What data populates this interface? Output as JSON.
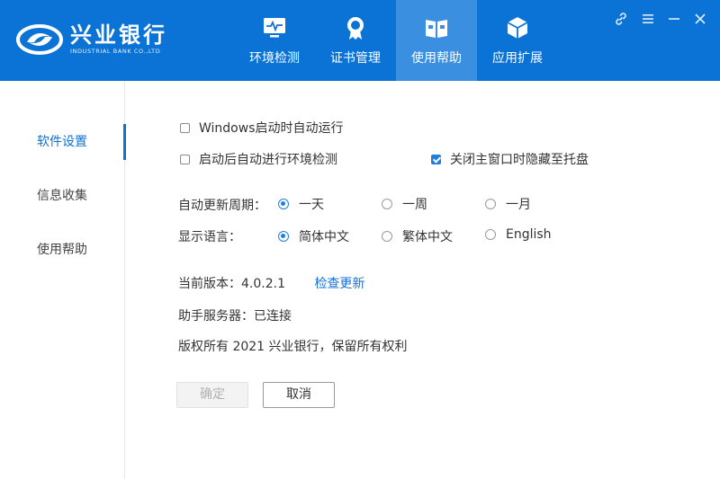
{
  "header": {
    "logo_cn": "兴业银行",
    "logo_en": "INDUSTRIAL BANK CO.,LTD",
    "tabs": [
      {
        "label": "环境检测",
        "icon": "monitor-icon",
        "active": false
      },
      {
        "label": "证书管理",
        "icon": "certificate-icon",
        "active": false
      },
      {
        "label": "使用帮助",
        "icon": "book-icon",
        "active": true
      },
      {
        "label": "应用扩展",
        "icon": "cube-icon",
        "active": false
      }
    ],
    "window_controls": [
      "link-icon",
      "menu-icon",
      "minimize-icon",
      "close-icon"
    ],
    "colors": {
      "bar": "#0c73d6",
      "active_tab": "#3a8fe0"
    }
  },
  "sidebar": {
    "items": [
      {
        "label": "软件设置",
        "active": true
      },
      {
        "label": "信息收集",
        "active": false
      },
      {
        "label": "使用帮助",
        "active": false
      }
    ]
  },
  "settings": {
    "autostart": {
      "label": "Windows启动时自动运行",
      "checked": false
    },
    "autocheck": {
      "label": "启动后自动进行环境检测",
      "checked": false
    },
    "hide_tray": {
      "label": "关闭主窗口时隐藏至托盘",
      "checked": true
    },
    "update_period": {
      "label": "自动更新周期：",
      "options": [
        "一天",
        "一周",
        "一月"
      ],
      "selected": "一天"
    },
    "language": {
      "label": "显示语言：",
      "options": [
        "简体中文",
        "繁体中文",
        "English"
      ],
      "selected": "简体中文"
    }
  },
  "info": {
    "version_label": "当前版本：",
    "version": "4.0.2.1",
    "check_update": "检查更新",
    "server": "助手服务器：已连接",
    "copyright": "版权所有 2021 兴业银行，保留所有权利"
  },
  "buttons": {
    "ok": "确定",
    "cancel": "取消"
  }
}
